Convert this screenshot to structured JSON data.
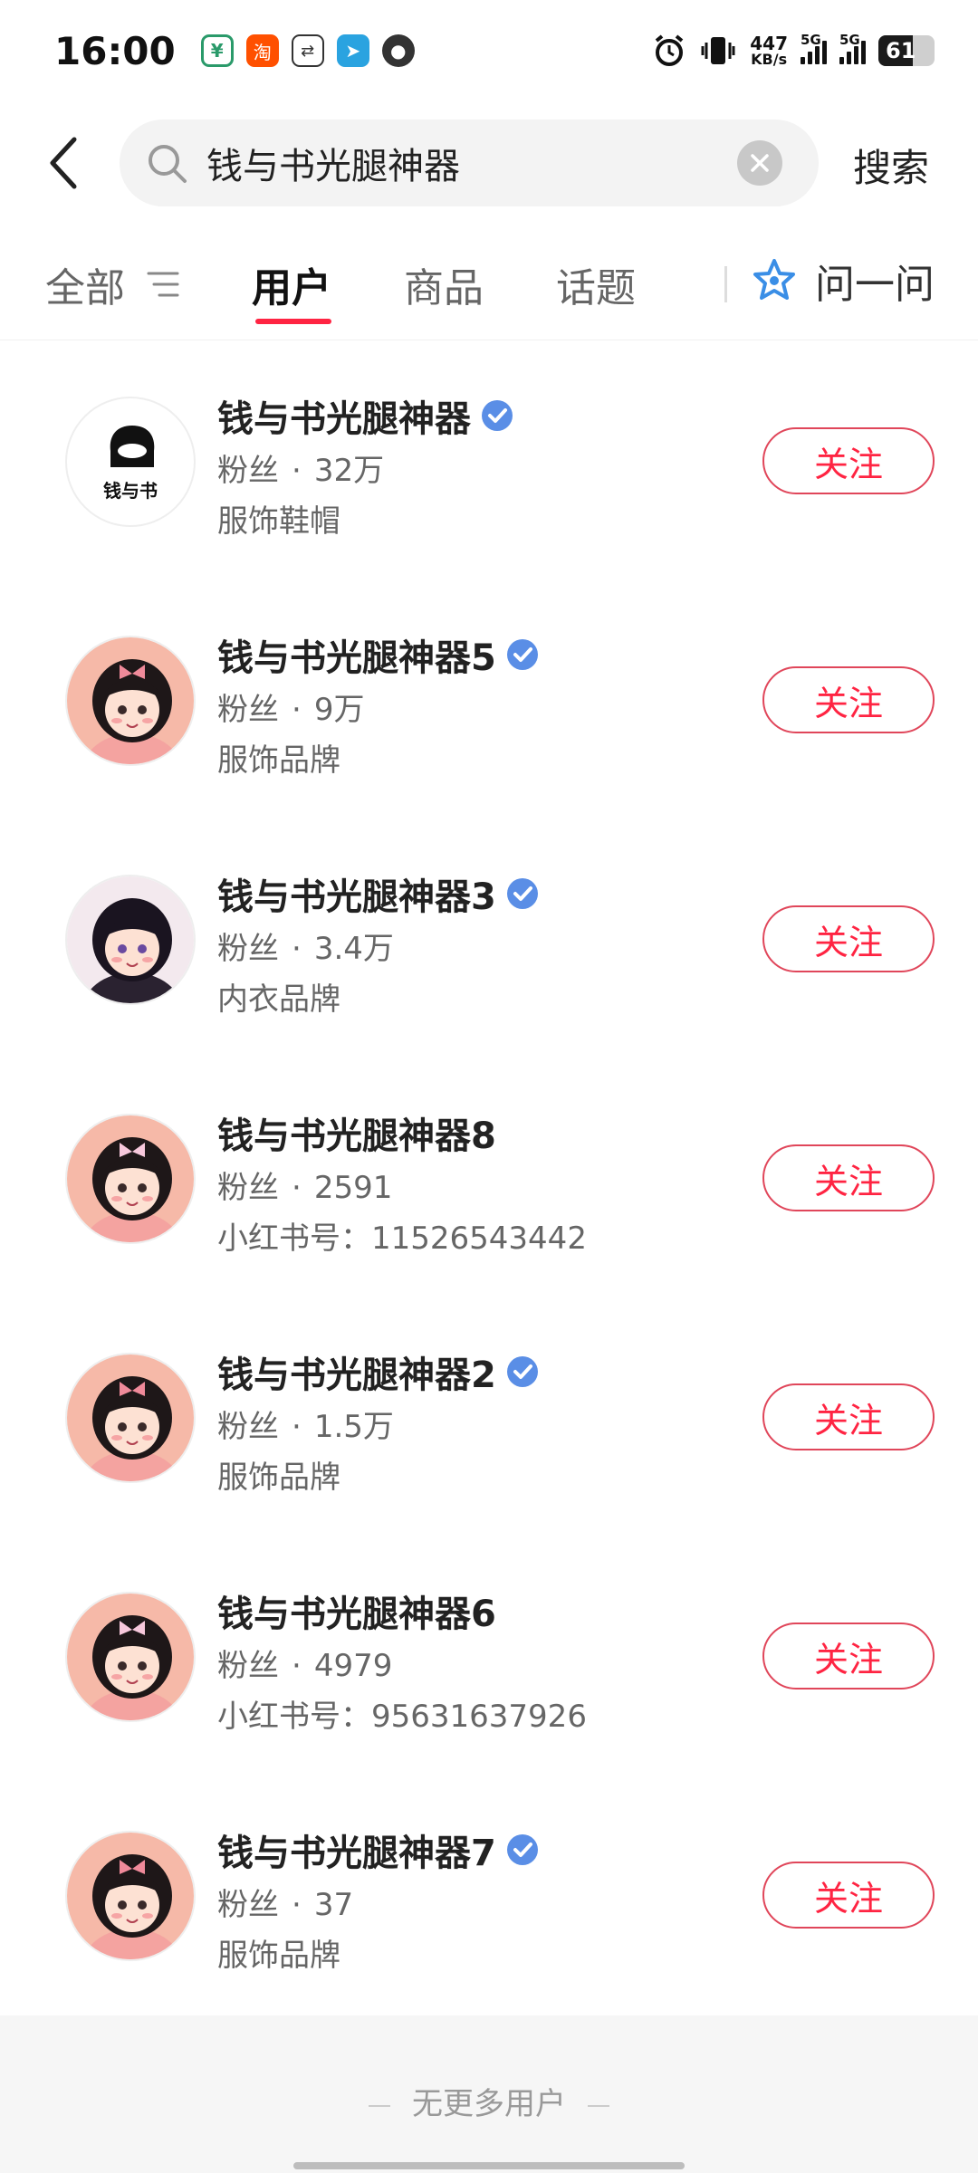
{
  "status_bar": {
    "time": "16:00",
    "speed_value": "447",
    "speed_unit": "KB/s",
    "sig1_label": "5G",
    "sig2_label": "5G",
    "battery": "61",
    "apps": [
      "bank-app-icon",
      "taobao-app-icon",
      "sync-app-icon",
      "telegram-app-icon",
      "camera-app-icon"
    ]
  },
  "search": {
    "query": "钱与书光腿神器",
    "submit_label": "搜索"
  },
  "tabs": {
    "all": "全部",
    "users": "用户",
    "goods": "商品",
    "topics": "话题",
    "ask": "问一问"
  },
  "colors": {
    "accent": "#ff2442",
    "verified": "#5a8ee6"
  },
  "users": [
    {
      "name": "钱与书光腿神器",
      "fans_label": "粉丝",
      "fans": "32万",
      "sub": "服饰鞋帽",
      "verified": true,
      "follow": "关注"
    },
    {
      "name": "钱与书光腿神器5",
      "fans_label": "粉丝",
      "fans": "9万",
      "sub": "服饰品牌",
      "verified": true,
      "follow": "关注"
    },
    {
      "name": "钱与书光腿神器3",
      "fans_label": "粉丝",
      "fans": "3.4万",
      "sub": "内衣品牌",
      "verified": true,
      "follow": "关注"
    },
    {
      "name": "钱与书光腿神器8",
      "fans_label": "粉丝",
      "fans": "2591",
      "sub": "小红书号：11526543442",
      "verified": false,
      "follow": "关注"
    },
    {
      "name": "钱与书光腿神器2",
      "fans_label": "粉丝",
      "fans": "1.5万",
      "sub": "服饰品牌",
      "verified": true,
      "follow": "关注"
    },
    {
      "name": "钱与书光腿神器6",
      "fans_label": "粉丝",
      "fans": "4979",
      "sub": "小红书号：95631637926",
      "verified": false,
      "follow": "关注"
    },
    {
      "name": "钱与书光腿神器7",
      "fans_label": "粉丝",
      "fans": "37",
      "sub": "服饰品牌",
      "verified": true,
      "follow": "关注"
    }
  ],
  "logo_text": "钱与书",
  "footer": {
    "no_more": "无更多用户"
  }
}
